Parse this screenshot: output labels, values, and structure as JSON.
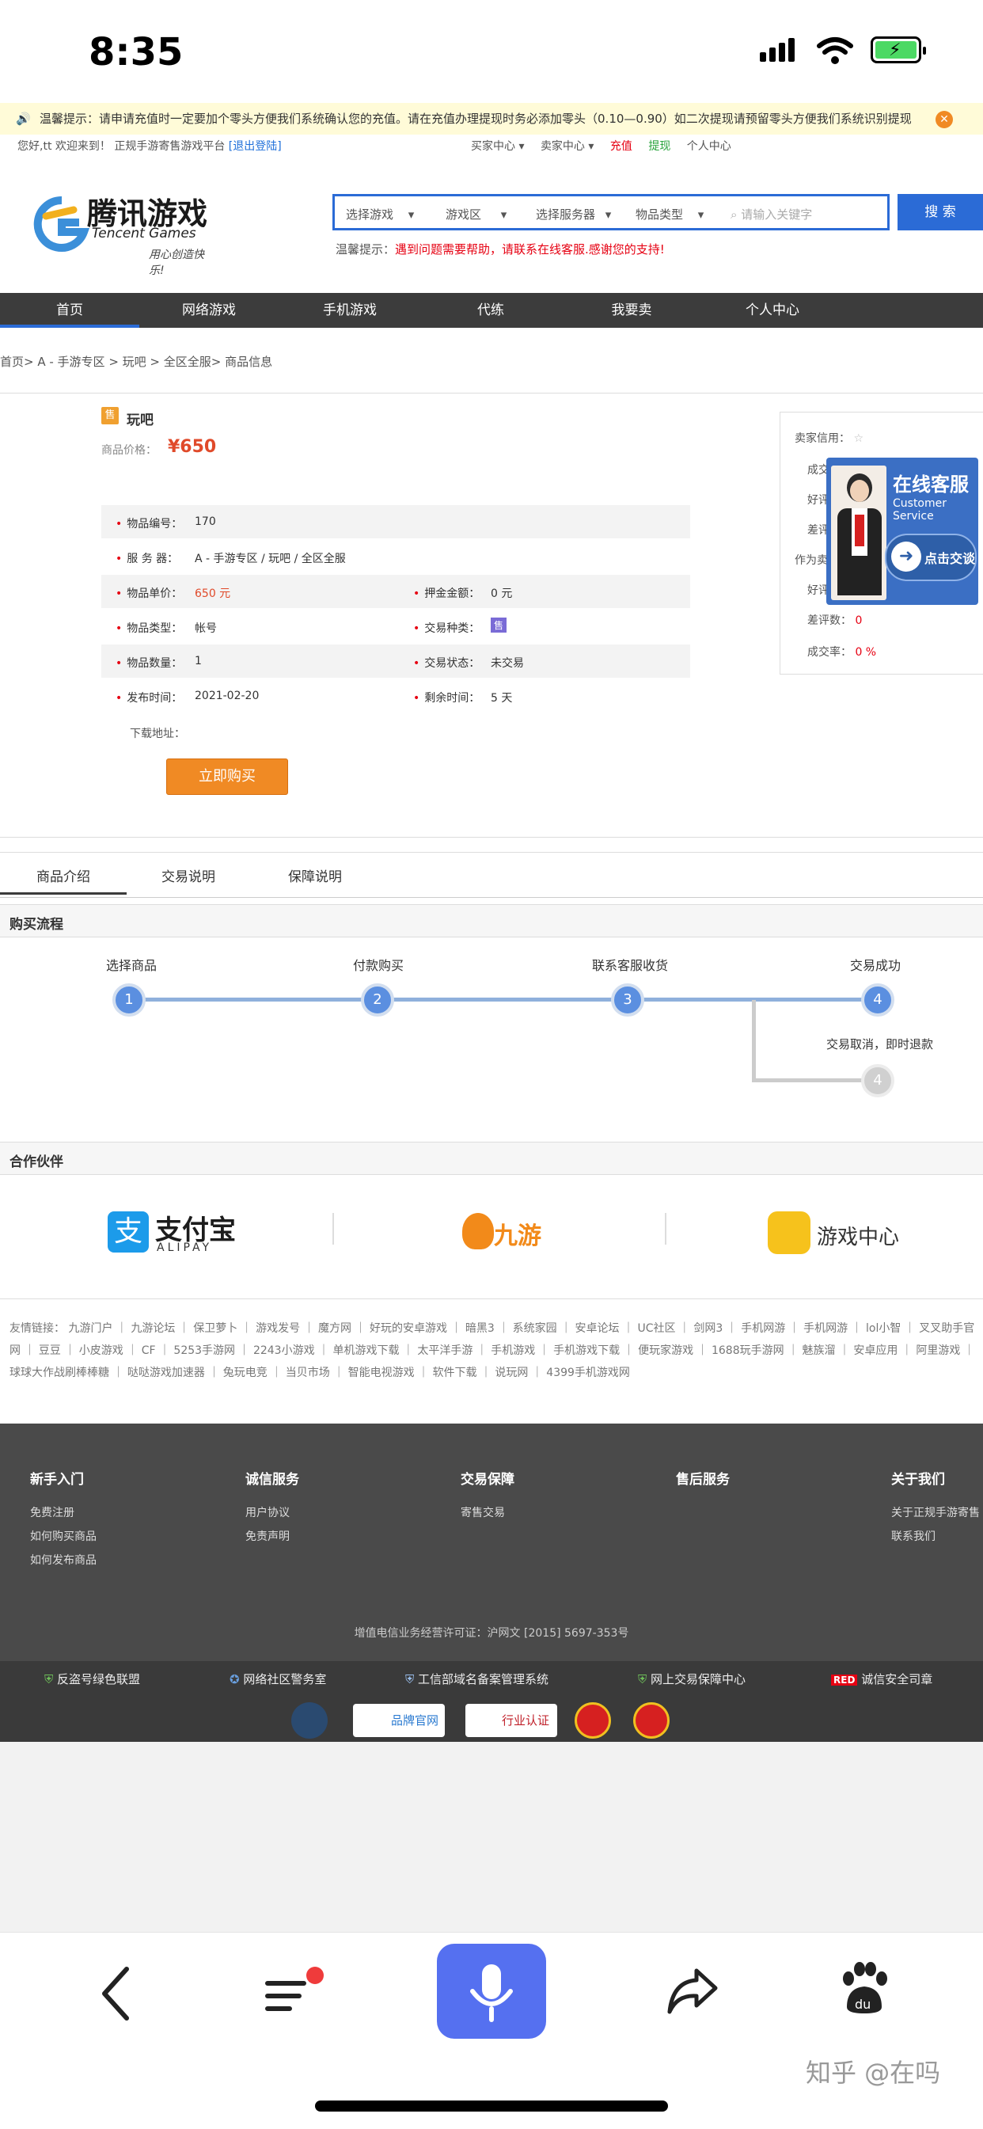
{
  "status": {
    "time": "8:35"
  },
  "notice": {
    "text": "温馨提示：请申请充值时一定要加个零头方便我们系统确认您的充值。请在充值办理提现时务必添加零头（0.10—0.90）如二次提现请预留零头方便我们系统识别提现"
  },
  "topbar": {
    "welcome": "您好,tt 欢迎来到！ 正规手游寄售游戏平台",
    "logout": "[退出登陆]",
    "links": [
      "买家中心 ▾",
      "卖家中心 ▾",
      "充值",
      "提现",
      "个人中心"
    ]
  },
  "logo": {
    "cn": "腾讯游戏",
    "en": "Tencent Games",
    "slogan": "用心创造快乐!"
  },
  "search": {
    "dropdowns": [
      "选择游戏",
      "游戏区",
      "选择服务器",
      "物品类型"
    ],
    "placeholder": "请输入关键字",
    "button": "搜 索",
    "tip_label": "温馨提示：",
    "tip_text": "遇到问题需要帮助，请联系在线客服.感谢您的支持!"
  },
  "nav": [
    "首页",
    "网络游戏",
    "手机游戏",
    "代练",
    "我要卖",
    "个人中心"
  ],
  "breadcrumb": "首页> A - 手游专区 > 玩吧 > 全区全服> 商品信息",
  "product": {
    "tag": "售",
    "name": "玩吧",
    "price_label": "商品价格：",
    "price": "¥650",
    "rows": [
      {
        "k": "物品编号：",
        "v": "170",
        "k2": "",
        "v2": ""
      },
      {
        "k": "服 务 器：",
        "v": "A - 手游专区 / 玩吧 / 全区全服",
        "k2": "",
        "v2": ""
      },
      {
        "k": "物品单价：",
        "v": "650 元",
        "k2": "押金金额：",
        "v2": "0 元"
      },
      {
        "k": "物品类型：",
        "v": "帐号",
        "k2": "交易种类：",
        "v2": "售"
      },
      {
        "k": "物品数量：",
        "v": "1",
        "k2": "交易状态：",
        "v2": "未交易"
      },
      {
        "k": "发布时间：",
        "v": "2021-02-20",
        "k2": "剩余时间：",
        "v2": "5 天"
      }
    ],
    "download_label": "下载地址：",
    "buy_button": "立即购买"
  },
  "seller": {
    "credit_label": "卖家信用：",
    "lines": [
      "成交率： 0 %",
      "好评",
      "差评",
      "作为卖",
      "好评",
      "差评数："
    ],
    "bad_count": "0",
    "rate_label": "成交率：",
    "rate_value": "0 %",
    "cs_title": "在线客服",
    "cs_en": "Customer Service",
    "cs_button": "点击交谈"
  },
  "tabs": [
    "商品介绍",
    "交易说明",
    "保障说明"
  ],
  "flow": {
    "title": "购买流程",
    "steps": [
      "选择商品",
      "付款购买",
      "联系客服收货",
      "交易成功"
    ],
    "nums": [
      "1",
      "2",
      "3",
      "4"
    ],
    "cancel": "交易取消，即时退款",
    "cancel_num": "4"
  },
  "partners": {
    "title": "合作伙伴",
    "items": [
      {
        "name": "支付宝",
        "sub": "ALIPAY"
      },
      {
        "name": "九游"
      },
      {
        "name": "游戏中心"
      }
    ]
  },
  "friend_links": "友情链接： 九游门户 ｜ 九游论坛 ｜ 保卫萝卜 ｜ 游戏发号 ｜ 魔方网 ｜ 好玩的安卓游戏 ｜ 暗黑3 ｜ 系统家园 ｜ 安卓论坛 ｜ UC社区 ｜ 剑网3 ｜ 手机网游 ｜ 手机网游 ｜ lol小智 ｜ 叉叉助手官网 ｜ 豆豆 ｜ 小皮游戏 ｜ CF ｜ 5253手游网 ｜ 2243小游戏 ｜ 单机游戏下载 ｜ 太平洋手游 ｜ 手机游戏 ｜ 手机游戏下载 ｜ 便玩家游戏 ｜ 1688玩手游网 ｜ 魅族溜 ｜ 安卓应用 ｜ 阿里游戏 ｜ 球球大作战刷棒棒糖 ｜ 哒哒游戏加速器 ｜ 兔玩电竞 ｜ 当贝市场 ｜ 智能电视游戏 ｜ 软件下载 ｜ 说玩网 ｜ 4399手机游戏网",
  "footer": {
    "cols": [
      {
        "h": "新手入门",
        "items": [
          "免费注册",
          "如何购买商品",
          "如何发布商品"
        ]
      },
      {
        "h": "诚信服务",
        "items": [
          "用户协议",
          "免责声明"
        ]
      },
      {
        "h": "交易保障",
        "items": [
          "寄售交易"
        ]
      },
      {
        "h": "售后服务",
        "items": []
      },
      {
        "h": "关于我们",
        "items": [
          "关于正规手游寄售",
          "联系我们"
        ]
      }
    ],
    "icp": "增值电信业务经营许可证：沪网文 [2015] 5697-353号"
  },
  "badges": [
    "反盗号绿色联盟",
    "网络社区警务室",
    "工信部域名备案管理系统",
    "网上交易保障中心",
    "诚信安全司章"
  ],
  "badge2": [
    "品牌官网",
    "行业认证"
  ],
  "browser": {
    "watermark": "知乎 @在吗"
  },
  "colors": {
    "accent": "#2b6bd6",
    "price": "#e04a2a",
    "buy": "#f08a24",
    "nav": "#3c3c3c"
  }
}
